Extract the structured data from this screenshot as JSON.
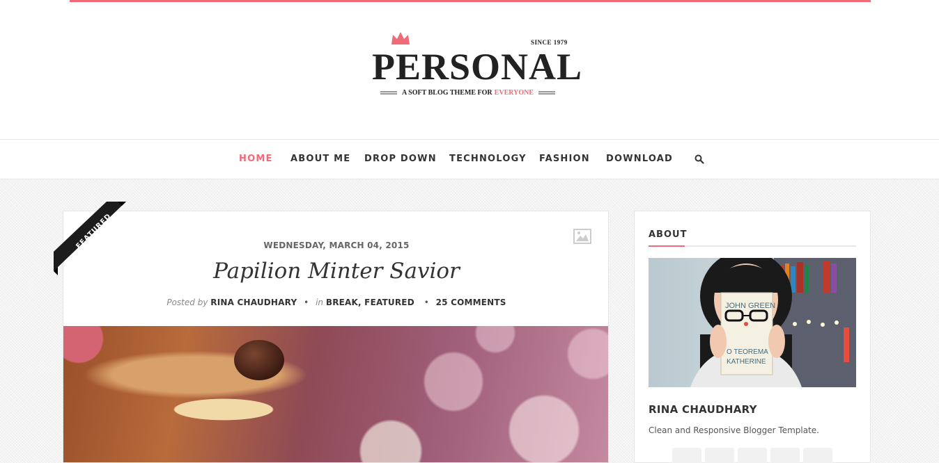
{
  "brand": {
    "since": "SINCE 1979",
    "title": "PERSONAL",
    "tagline_prefix": "A SOFT BLOG THEME FOR",
    "tagline_accent": "EVERYONE",
    "accent_color": "#f06b78"
  },
  "nav": {
    "items": [
      {
        "label": "HOME",
        "active": true
      },
      {
        "label": "ABOUT ME"
      },
      {
        "label": "DROP DOWN"
      },
      {
        "label": "TECHNOLOGY"
      },
      {
        "label": "FASHION"
      },
      {
        "label": "DOWNLOAD"
      }
    ],
    "search_icon": "search-icon"
  },
  "post": {
    "badge": "FEATURED",
    "format_icon": "image-icon",
    "date": "WEDNESDAY, MARCH 04, 2015",
    "title": "Papilion Minter Savior",
    "posted_by_label": "Posted by",
    "author": "RINA CHAUDHARY",
    "in_label": "in",
    "categories": [
      "BREAK",
      "FEATURED"
    ],
    "comments": "25 COMMENTS"
  },
  "sidebar": {
    "about": {
      "title": "ABOUT",
      "name": "RINA CHAUDHARY",
      "description": "Clean and Responsive Blogger Template.",
      "photo_book_text": [
        "JOHN GREEN",
        "O TEOREMA",
        "KATHERINE"
      ]
    }
  }
}
